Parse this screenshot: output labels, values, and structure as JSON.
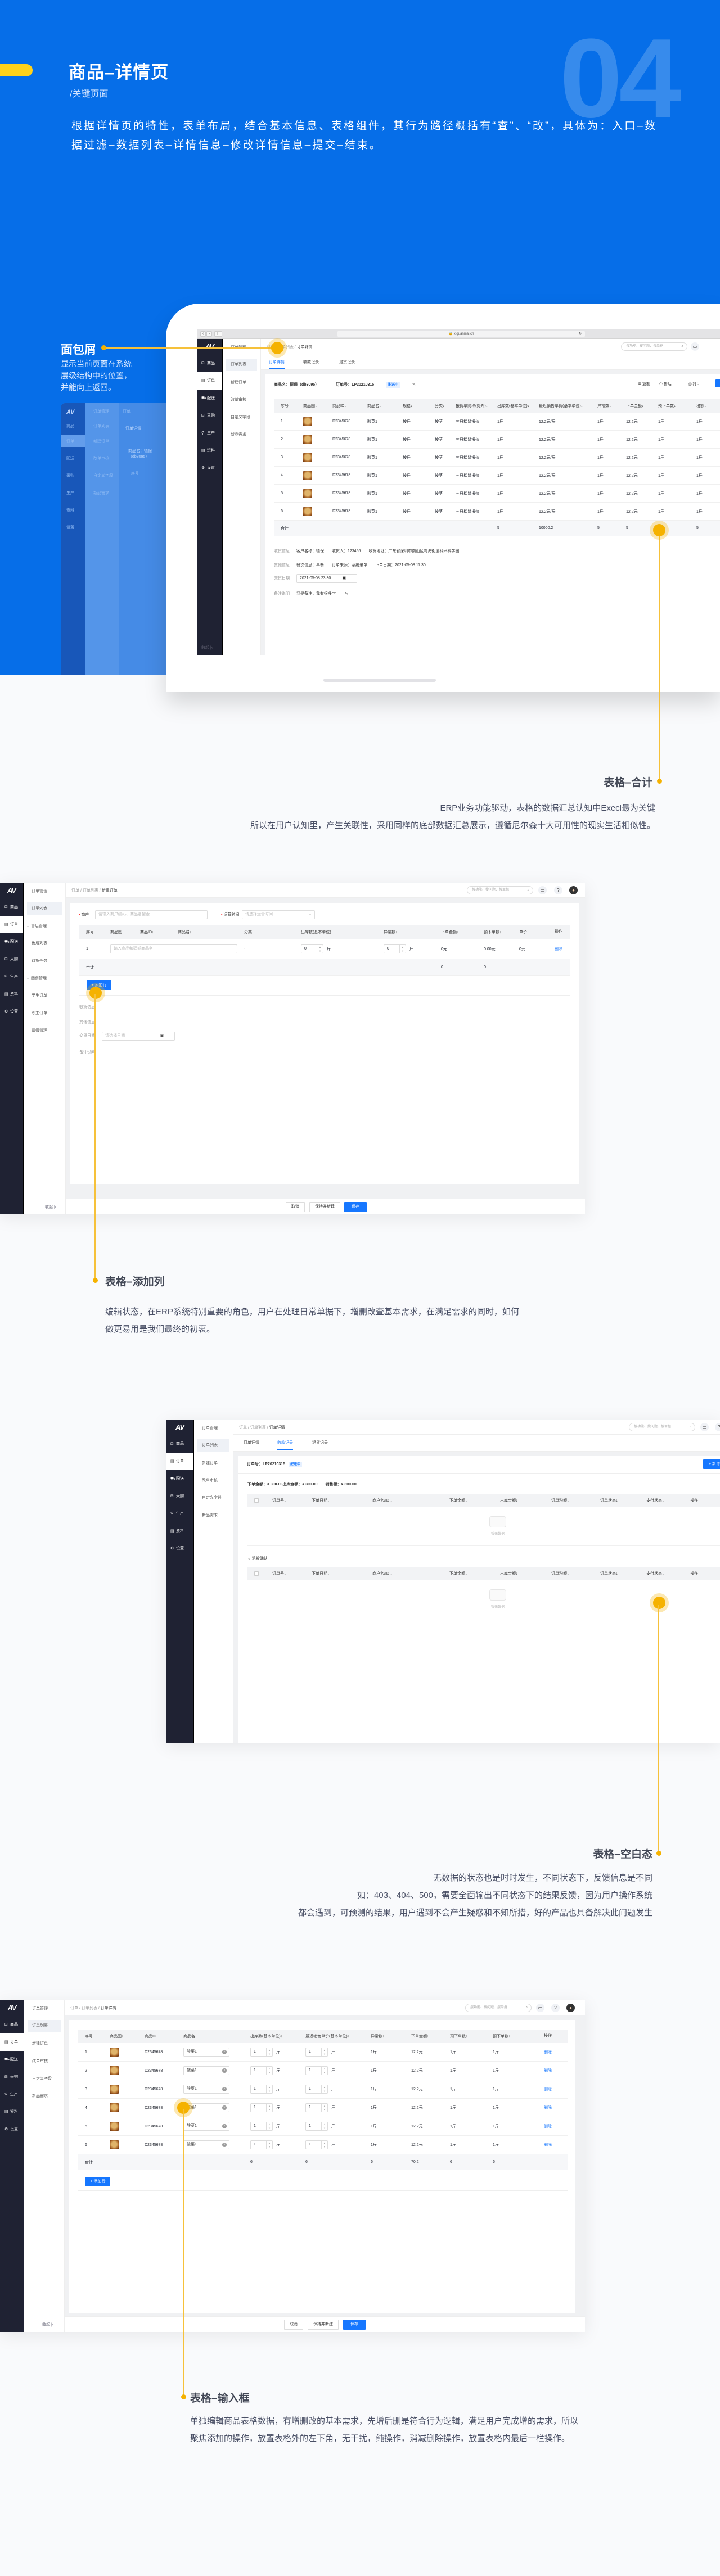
{
  "hero": {
    "title": "商品–详情页",
    "subtitle": "/关键页面",
    "number": "04",
    "description": "根据详情页的特性，表单布局，结合基本信息、表格组件，其行为路径概括有“查”、“改”，具体为：入口–数据过滤–数据列表–详情信息–修改详情信息–提交–结束。"
  },
  "callouts": {
    "breadcrumb": {
      "title": "面包屑",
      "lines": [
        "显示当前页面在系统",
        "层级结构中的位置，",
        "并能向上返回。"
      ]
    },
    "total": {
      "title": "表格–合计",
      "lines": [
        "ERP业务功能驱动，表格的数据汇总认知中Execl最为关键",
        "所以在用户认知里，产生关联性，采用同样的底部数据汇总展示，遵循尼尔森十大可用性的现实生活相似性。"
      ]
    },
    "add_row": {
      "title": "表格–添加列",
      "lines": [
        "编辑状态，在ERP系统特别重要的角色，用户在处理日常单据下，增删改查基本需求，在满足需求的同时，如何",
        "做更易用是我们最终的初衷。"
      ]
    },
    "empty": {
      "title": "表格–空白态",
      "lines": [
        "无数据的状态也是时时发生，不同状态下，反馈信息是不同",
        "如：403、404、500，需要全面输出不同状态下的结果反馈，因为用户操作系统",
        "都会遇到，可预测的结果，用户遇到不会产生疑惑和不知所措，好的产品也具备解决此问题发生"
      ]
    },
    "input": {
      "title": "表格–输入框",
      "lines": [
        "单独编辑商品表格数据，有增删改的基本需求，先增后删是符合行为逻辑，满足用户完成增的需求，所以",
        "聚焦添加的操作，放置表格外的左下角，无干扰，纯操作，消减删除操作，放置表格内最后一栏操作。"
      ]
    }
  },
  "app": {
    "logo": "AV",
    "url": "x.guanmai.cn",
    "search_placeholder": "搜功能、搜问题、搜单据",
    "collapse": "收起",
    "nav": [
      {
        "label": "商品",
        "icon": "goods-icon"
      },
      {
        "label": "订单",
        "icon": "order-icon"
      },
      {
        "label": "配送",
        "icon": "truck-icon"
      },
      {
        "label": "采购",
        "icon": "purchase-icon"
      },
      {
        "label": "生产",
        "icon": "wrench-icon"
      },
      {
        "label": "资料",
        "icon": "document-icon"
      },
      {
        "label": "设置",
        "icon": "gear-icon"
      }
    ],
    "subnav": [
      "订单管理",
      "订单列表",
      "新建订单",
      "改单审核",
      "自定义字段",
      "新品需求"
    ],
    "subnav_aftersale": [
      "订单管理",
      "订单列表",
      "售后管理",
      "售后列表",
      "取货任务",
      "团餐管理",
      "学生订单",
      "职工订单",
      "请假管理"
    ],
    "footer": {
      "cancel": "取消",
      "save_new": "保持并新建",
      "save": "保存"
    },
    "add_row": "+ 添加行",
    "delete": "删除",
    "unit": "斤"
  },
  "mock1": {
    "breadcrumb": [
      "订单",
      "订单列表",
      "订单详情"
    ],
    "tabs": [
      "订单详情",
      "收款记录",
      "退货记录"
    ],
    "product": "商品名：德保（db3095）",
    "order_no": "订单号：LP20210315",
    "status": "配送中",
    "actions": [
      "复制",
      "售后",
      "打印"
    ],
    "table": {
      "columns": [
        "序号",
        "商品图↓",
        "商品ID↓",
        "商品名↓",
        "规格↓",
        "分类↓",
        "报价单简称(对外)↓",
        "出库数(基本单位)↓",
        "最近销售单价(基本单位)↓",
        "异常数↓",
        "下单金额↓",
        "预下单数↓",
        "税额↓"
      ],
      "rows": [
        [
          "1",
          "D2345678",
          "酸菜1",
          "按斤",
          "按茎",
          "三只松鼠报价",
          "1斤",
          "12.2元/斤",
          "1斤",
          "12.2元",
          "1斤",
          "1斤"
        ],
        [
          "2",
          "D2345678",
          "酸菜1",
          "按斤",
          "按茎",
          "三只松鼠报价",
          "1斤",
          "12.2元/斤",
          "1斤",
          "12.2元",
          "1斤",
          "1斤"
        ],
        [
          "3",
          "D2345678",
          "酸菜1",
          "按斤",
          "按茎",
          "三只松鼠报价",
          "1斤",
          "12.2元/斤",
          "1斤",
          "12.2元",
          "1斤",
          "1斤"
        ],
        [
          "4",
          "D2345678",
          "酸菜1",
          "按斤",
          "按茎",
          "三只松鼠报价",
          "1斤",
          "12.2元/斤",
          "1斤",
          "12.2元",
          "1斤",
          "1斤"
        ],
        [
          "5",
          "D2345678",
          "酸菜1",
          "按斤",
          "按茎",
          "三只松鼠报价",
          "1斤",
          "12.2元/斤",
          "1斤",
          "12.2元",
          "1斤",
          "1斤"
        ],
        [
          "6",
          "D2345678",
          "酸菜1",
          "按斤",
          "按茎",
          "三只松鼠报价",
          "1斤",
          "12.2元/斤",
          "1斤",
          "12.2元",
          "1斤",
          "1斤"
        ]
      ],
      "totals": [
        "合计",
        null,
        null,
        null,
        null,
        null,
        null,
        "5",
        "10000.2",
        "5",
        "5",
        "5",
        "5"
      ]
    },
    "info": {
      "receive_label": "收货信息",
      "customer": "客户名称：德保",
      "receiver": "收货人：123456",
      "address": "收货地址：广东省深圳市南山区粤海街道科兴科学园",
      "other_label": "其他信息",
      "meal": "餐次信息：早餐",
      "source": "订单来源：系统录单",
      "order_date": "下单日期：2021-05-08 11:30",
      "delivery_label": "交货日期",
      "delivery_value": "2021-05-08 23:30",
      "remark_label": "备注说明",
      "remark_value": "我是备注，我有很多字"
    }
  },
  "mock2": {
    "breadcrumb": [
      "订单",
      "订单列表",
      "新建订单"
    ],
    "merchant_label": "商户",
    "merchant_placeholder": "请输入商户编码、商品名搜索",
    "time_label": "运营时间",
    "time_placeholder": "请选择运营时间",
    "columns": [
      "序号",
      "商品图↓",
      "商品ID↓",
      "商品名↓",
      "分类↓",
      "出库数(基本单位)↓",
      "异常数↓",
      "下单金额↓",
      "预下单数↓",
      "单价↓",
      "操作"
    ],
    "row": {
      "index": "1",
      "product_placeholder": "输入商品编码或商品名",
      "category": "-",
      "out_qty": "0",
      "abnormal": "0",
      "amount": "0元",
      "pre_amount": "0.00元",
      "price": "0元"
    },
    "totals": {
      "label": "合计",
      "amount": "0",
      "pre_amount": "0"
    },
    "info": {
      "receive_label": "收货信息",
      "other_label": "其他信息",
      "delivery_label": "交货日期",
      "delivery_placeholder": "请选择日期",
      "remark_label": "备注说明"
    }
  },
  "mock3": {
    "breadcrumb": [
      "订单",
      "订单列表",
      "订单详情"
    ],
    "tabs": [
      "订单详情",
      "收款记录",
      "退货记录"
    ],
    "order_no": "订单号：LP20210315",
    "status": "配送中",
    "new_button": "+ 新增",
    "amounts": [
      "下单金额：¥ 300.00",
      "出库金额：¥ 300.00",
      "销售额：¥ 300.00"
    ],
    "columns": [
      "订单号↓",
      "下单日期↓",
      "商户名/ID ↓",
      "下单金额↓",
      "出库金额↓",
      "订单税额↓",
      "订单状态↓",
      "支付状态↓",
      "操作"
    ],
    "empty_text": "暂无数据",
    "refund_section": "退款确认"
  },
  "mock4": {
    "breadcrumb": [
      "订单",
      "订单列表",
      "订单详情"
    ],
    "table": {
      "columns": [
        "序号",
        "商品图↓",
        "商品ID↓",
        "商品名↓",
        "出库数(基本单位)↓",
        "最近销售单价(基本单位)↓",
        "异常数↓",
        "下单金额↓",
        "预下单数↓",
        "预下单数↓",
        "操作"
      ],
      "rows": [
        [
          "1",
          "D2345678",
          "酸菜1",
          "1",
          "1",
          "1斤",
          "12.2元",
          "1斤",
          "1斤",
          "删除"
        ],
        [
          "2",
          "D2345678",
          "酸菜1",
          "1",
          "1",
          "1斤",
          "12.2元",
          "1斤",
          "1斤",
          "删除"
        ],
        [
          "3",
          "D2345678",
          "酸菜1",
          "1",
          "1",
          "1斤",
          "12.2元",
          "1斤",
          "1斤",
          "删除"
        ],
        [
          "4",
          "D2345678",
          "酸菜1",
          "1",
          "1",
          "1斤",
          "12.2元",
          "1斤",
          "1斤",
          "删除"
        ],
        [
          "5",
          "D2345678",
          "酸菜1",
          "1",
          "1",
          "1斤",
          "12.2元",
          "1斤",
          "1斤",
          "删除"
        ],
        [
          "6",
          "D2345678",
          "酸菜1",
          "1",
          "1",
          "1斤",
          "12.2元",
          "1斤",
          "1斤",
          "删除"
        ]
      ],
      "totals": [
        "合计",
        null,
        null,
        null,
        "6",
        "6",
        "6",
        "70.2",
        "6",
        "6",
        null
      ]
    }
  },
  "colors": {
    "hero_blue": "#066ee8",
    "accent": "#1677ff",
    "highlight": "#f6c13a",
    "sidebar": "#1f2233"
  }
}
